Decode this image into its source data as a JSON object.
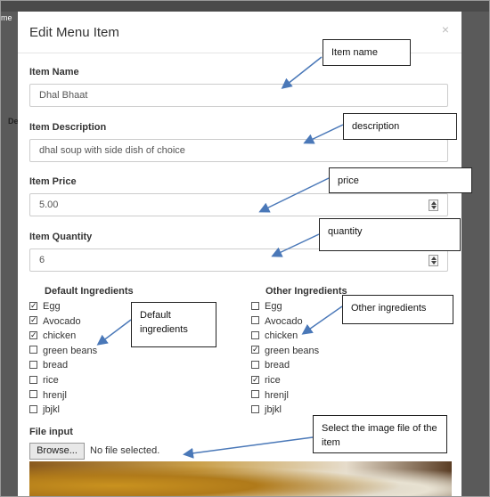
{
  "modal": {
    "title": "Edit Menu Item",
    "close": "×"
  },
  "fields": {
    "name": {
      "label": "Item Name",
      "value": "Dhal Bhaat"
    },
    "description": {
      "label": "Item Description",
      "value": "dhal soup with side dish of choice"
    },
    "price": {
      "label": "Item Price",
      "value": "5.00"
    },
    "quantity": {
      "label": "Item Quantity",
      "value": "6"
    }
  },
  "default_ingredients": {
    "heading": "Default Ingredients",
    "items": [
      {
        "label": "Egg",
        "checked": true
      },
      {
        "label": "Avocado",
        "checked": true
      },
      {
        "label": "chicken",
        "checked": true
      },
      {
        "label": "green beans",
        "checked": false
      },
      {
        "label": "bread",
        "checked": false
      },
      {
        "label": "rice",
        "checked": false
      },
      {
        "label": "hrenjl",
        "checked": false
      },
      {
        "label": "jbjkl",
        "checked": false
      }
    ]
  },
  "other_ingredients": {
    "heading": "Other Ingredients",
    "items": [
      {
        "label": "Egg",
        "checked": false
      },
      {
        "label": "Avocado",
        "checked": false
      },
      {
        "label": "chicken",
        "checked": false
      },
      {
        "label": "green beans",
        "checked": true
      },
      {
        "label": "bread",
        "checked": false
      },
      {
        "label": "rice",
        "checked": true
      },
      {
        "label": "hrenjl",
        "checked": false
      },
      {
        "label": "jbjkl",
        "checked": false
      }
    ]
  },
  "file_input": {
    "label": "File input",
    "browse": "Browse...",
    "status": "No file selected."
  },
  "background": {
    "top_text": "me",
    "side_text": "De"
  },
  "callouts": {
    "name": "Item name",
    "description": "description",
    "price": "price",
    "quantity": "quantity",
    "default_ingredients": "Default ingredients",
    "other_ingredients": "Other ingredients",
    "image": "Select the image file of the item"
  }
}
